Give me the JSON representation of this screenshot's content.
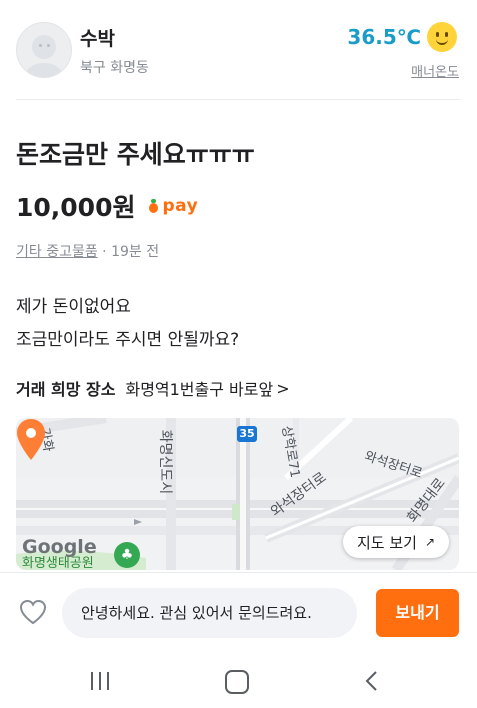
{
  "seller": {
    "name": "수박",
    "location": "북구 화명동",
    "temperature": "36.5℃",
    "manner_label": "매너온도"
  },
  "article": {
    "title": "돈조금만 주세요ㅠㅠㅠ",
    "price": "10,000원",
    "pay_label": "pay",
    "category": "기타 중고물품",
    "time": " · 19분 전",
    "description_line1": "제가 돈이없어요",
    "description_line2": "조금만이라도 주시면 안될까요?"
  },
  "place": {
    "label": "거래 희망 장소",
    "value": "화명역1번출구 바로앞",
    "arrow": ">"
  },
  "map": {
    "view_button": "지도 보기",
    "google_logo": "Google",
    "route_number": "35",
    "labels": {
      "top_left_a": "가화",
      "top_left_b": "도",
      "road_vertical": "화명신도시",
      "road_top": "상학로71",
      "road_right_top": "와석장터로",
      "road_center": "와석장터로",
      "road_right": "화명대로",
      "park": "화명생태공원"
    }
  },
  "chat": {
    "message": "안녕하세요. 관심 있어서 문의드려요.",
    "send_label": "보내기"
  },
  "colors": {
    "accent": "#ff6f0f",
    "temperature": "#1a9cc8",
    "muted_text": "#868b94"
  }
}
